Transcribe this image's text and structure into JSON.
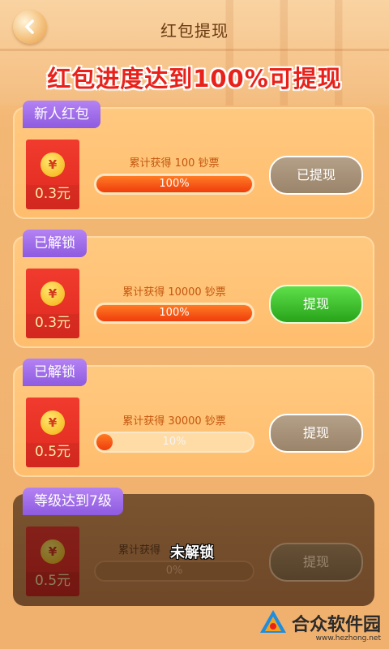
{
  "header": {
    "title": "红包提现",
    "headline": "红包进度达到100%可提现"
  },
  "cards": [
    {
      "tag": "新人红包",
      "amount": "0.3元",
      "requirement": "累计获得 100 钞票",
      "progress": 1.0,
      "progress_label": "100%",
      "button": "已提现",
      "locked": false
    },
    {
      "tag": "已解锁",
      "amount": "0.3元",
      "requirement": "累计获得 10000 钞票",
      "progress": 1.0,
      "progress_label": "100%",
      "button": "提现",
      "locked": false
    },
    {
      "tag": "已解锁",
      "amount": "0.5元",
      "requirement": "累计获得 30000 钞票",
      "progress": 0.1,
      "progress_label": "10%",
      "button": "提现",
      "locked": false
    },
    {
      "tag": "等级达到7级",
      "amount": "0.5元",
      "requirement": "累计获得",
      "progress": 0.0,
      "progress_label": "0%",
      "button": "提现",
      "locked": true,
      "lock_label": "未解锁"
    }
  ],
  "coin_symbol": "¥",
  "watermark": {
    "name": "合众软件园",
    "url": "www.hezhong.net"
  },
  "colors": {
    "accent_red": "#e8221b",
    "tag_purple": "#9b68e8",
    "button_green": "#3bbf28",
    "button_gray": "#a89276"
  }
}
